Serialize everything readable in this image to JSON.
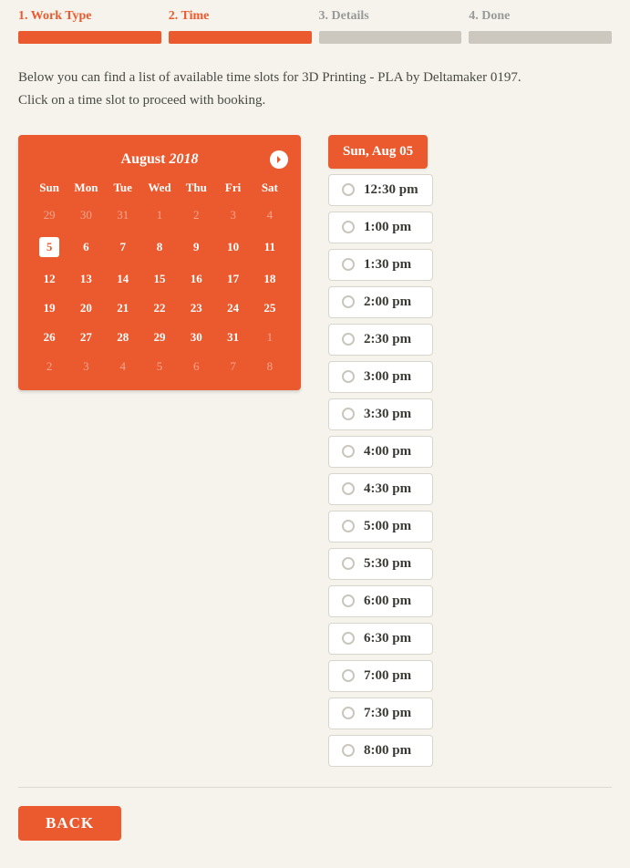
{
  "steps": [
    {
      "label": "1. Work Type",
      "active": true
    },
    {
      "label": "2. Time",
      "active": true
    },
    {
      "label": "3. Details",
      "active": false
    },
    {
      "label": "4. Done",
      "active": false
    }
  ],
  "intro_line1": "Below you can find a list of available time slots for 3D Printing - PLA by Deltamaker 0197.",
  "intro_line2": "Click on a time slot to proceed with booking.",
  "calendar": {
    "month": "August",
    "year": "2018",
    "dow": [
      "Sun",
      "Mon",
      "Tue",
      "Wed",
      "Thu",
      "Fri",
      "Sat"
    ],
    "days": [
      {
        "n": "29",
        "dim": true
      },
      {
        "n": "30",
        "dim": true
      },
      {
        "n": "31",
        "dim": true
      },
      {
        "n": "1",
        "dim": true
      },
      {
        "n": "2",
        "dim": true
      },
      {
        "n": "3",
        "dim": true
      },
      {
        "n": "4",
        "dim": true
      },
      {
        "n": "5",
        "selected": true
      },
      {
        "n": "6"
      },
      {
        "n": "7"
      },
      {
        "n": "8"
      },
      {
        "n": "9"
      },
      {
        "n": "10"
      },
      {
        "n": "11"
      },
      {
        "n": "12"
      },
      {
        "n": "13"
      },
      {
        "n": "14"
      },
      {
        "n": "15"
      },
      {
        "n": "16"
      },
      {
        "n": "17"
      },
      {
        "n": "18"
      },
      {
        "n": "19"
      },
      {
        "n": "20"
      },
      {
        "n": "21"
      },
      {
        "n": "22"
      },
      {
        "n": "23"
      },
      {
        "n": "24"
      },
      {
        "n": "25"
      },
      {
        "n": "26"
      },
      {
        "n": "27"
      },
      {
        "n": "28"
      },
      {
        "n": "29"
      },
      {
        "n": "30"
      },
      {
        "n": "31"
      },
      {
        "n": "1",
        "dim": true
      },
      {
        "n": "2",
        "dim": true
      },
      {
        "n": "3",
        "dim": true
      },
      {
        "n": "4",
        "dim": true
      },
      {
        "n": "5",
        "dim": true
      },
      {
        "n": "6",
        "dim": true
      },
      {
        "n": "7",
        "dim": true
      },
      {
        "n": "8",
        "dim": true
      }
    ]
  },
  "slots": {
    "date_header": "Sun, Aug 05",
    "times": [
      "12:30 pm",
      "1:00 pm",
      "1:30 pm",
      "2:00 pm",
      "2:30 pm",
      "3:00 pm",
      "3:30 pm",
      "4:00 pm",
      "4:30 pm",
      "5:00 pm",
      "5:30 pm",
      "6:00 pm",
      "6:30 pm",
      "7:00 pm",
      "7:30 pm",
      "8:00 pm"
    ]
  },
  "back_label": "BACK"
}
